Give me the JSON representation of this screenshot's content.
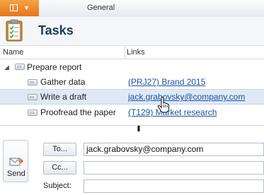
{
  "top_bar": {
    "tab": "General"
  },
  "header": {
    "title": "Tasks"
  },
  "table": {
    "columns": {
      "name": "Name",
      "links": "Links"
    },
    "rows": [
      {
        "name": "Prepare report",
        "link": ""
      },
      {
        "name": "Gather data",
        "link": "(PRJ27) Brand 2015"
      },
      {
        "name": "Write a draft",
        "link": "jack.grabovsky@company.com"
      },
      {
        "name": "Proofread the paper",
        "link": "(T129) Market research"
      }
    ]
  },
  "email": {
    "send_label": "Send",
    "to_label": "To...",
    "cc_label": "Cc...",
    "subject_label": "Subject:",
    "to_value": "jack.grabovsky@company.com",
    "cc_value": "",
    "subject_value": ""
  },
  "colors": {
    "accent": "#e7741a",
    "link": "#1c52a5",
    "selected_row": "#dfe9f6"
  }
}
